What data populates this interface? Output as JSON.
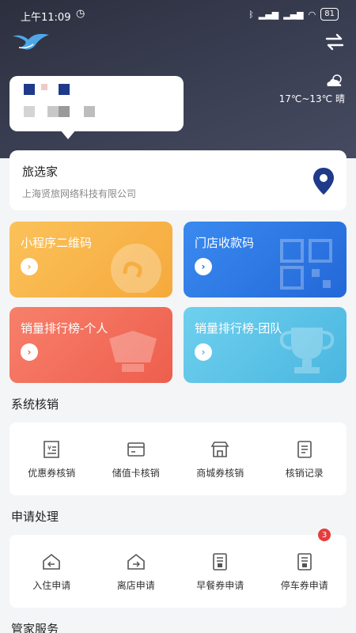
{
  "status_bar": {
    "time": "上午11:09",
    "battery": "81"
  },
  "weather": {
    "temperature": "17℃~13℃",
    "condition": "晴"
  },
  "store": {
    "name": "旅选家",
    "company": "上海贤旅网络科技有限公司"
  },
  "tiles": [
    {
      "label": "小程序二维码",
      "color": "#f7b54a"
    },
    {
      "label": "门店收款码",
      "color": "#2f7be8"
    },
    {
      "label": "销量排行榜-个人",
      "color": "#f26d5b"
    },
    {
      "label": "销量排行榜-团队",
      "color": "#5ec4e6"
    }
  ],
  "verification": {
    "title": "系统核销",
    "items": [
      {
        "label": "优惠券核销",
        "icon": "coupon-icon"
      },
      {
        "label": "储值卡核销",
        "icon": "card-icon"
      },
      {
        "label": "商城券核销",
        "icon": "shop-icon"
      },
      {
        "label": "核销记录",
        "icon": "record-icon"
      }
    ]
  },
  "applications": {
    "title": "申请处理",
    "items": [
      {
        "label": "入住申请",
        "icon": "checkin-icon"
      },
      {
        "label": "离店申请",
        "icon": "checkout-icon"
      },
      {
        "label": "早餐券申请",
        "icon": "breakfast-ticket-icon"
      },
      {
        "label": "停车券申请",
        "icon": "parking-ticket-icon",
        "badge": "3"
      }
    ]
  },
  "butler": {
    "title": "管家服务"
  },
  "colors": {
    "accent_blue": "#1f3a8a",
    "badge_red": "#e63c3c"
  }
}
